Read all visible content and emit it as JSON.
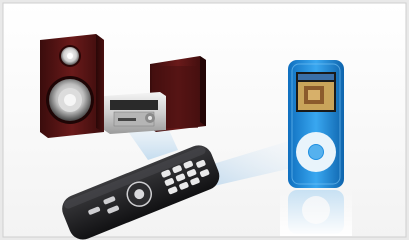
{
  "scene": {
    "description_items": [
      "left-speaker",
      "right-speaker",
      "micro-system-unit",
      "remote-control",
      "blue-media-player"
    ],
    "colors": {
      "border": "#cfcfcf",
      "speaker_wood": "#5a1414",
      "speaker_wood_highlight": "#8e2a2a",
      "unit_silver": "#d8d8d8",
      "remote_body": "#1b1b1d",
      "player_blue": "#1f8fe0",
      "player_screen": "#c9a45a",
      "beam": "#cfe3f3"
    }
  }
}
